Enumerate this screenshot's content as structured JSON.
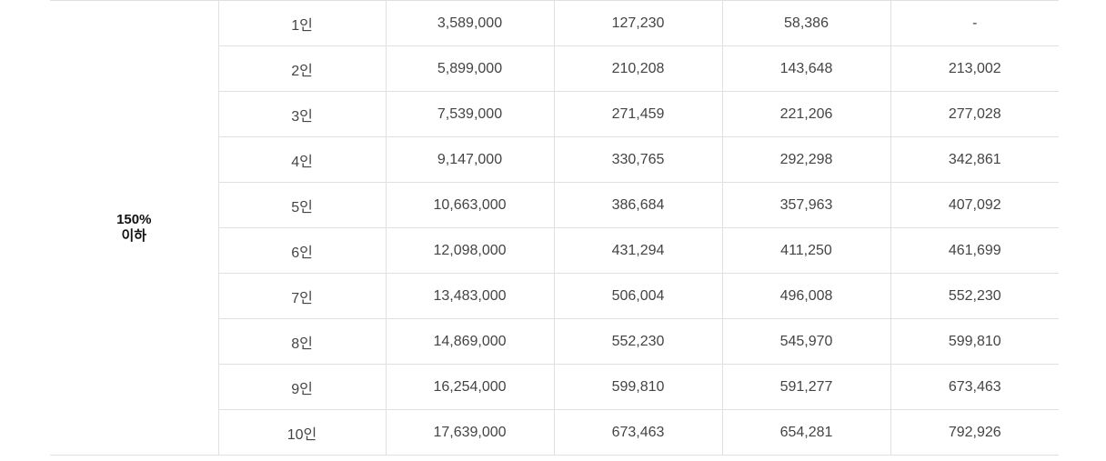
{
  "table": {
    "group_label_line1": "150%",
    "group_label_line2": "이하",
    "rows": [
      {
        "size": "1인",
        "v1": "3,589,000",
        "v2": "127,230",
        "v3": "58,386",
        "v4": "-"
      },
      {
        "size": "2인",
        "v1": "5,899,000",
        "v2": "210,208",
        "v3": "143,648",
        "v4": "213,002"
      },
      {
        "size": "3인",
        "v1": "7,539,000",
        "v2": "271,459",
        "v3": "221,206",
        "v4": "277,028"
      },
      {
        "size": "4인",
        "v1": "9,147,000",
        "v2": "330,765",
        "v3": "292,298",
        "v4": "342,861"
      },
      {
        "size": "5인",
        "v1": "10,663,000",
        "v2": "386,684",
        "v3": "357,963",
        "v4": "407,092"
      },
      {
        "size": "6인",
        "v1": "12,098,000",
        "v2": "431,294",
        "v3": "411,250",
        "v4": "461,699"
      },
      {
        "size": "7인",
        "v1": "13,483,000",
        "v2": "506,004",
        "v3": "496,008",
        "v4": "552,230"
      },
      {
        "size": "8인",
        "v1": "14,869,000",
        "v2": "552,230",
        "v3": "545,970",
        "v4": "599,810"
      },
      {
        "size": "9인",
        "v1": "16,254,000",
        "v2": "599,810",
        "v3": "591,277",
        "v4": "673,463"
      },
      {
        "size": "10인",
        "v1": "17,639,000",
        "v2": "673,463",
        "v3": "654,281",
        "v4": "792,926"
      }
    ]
  }
}
